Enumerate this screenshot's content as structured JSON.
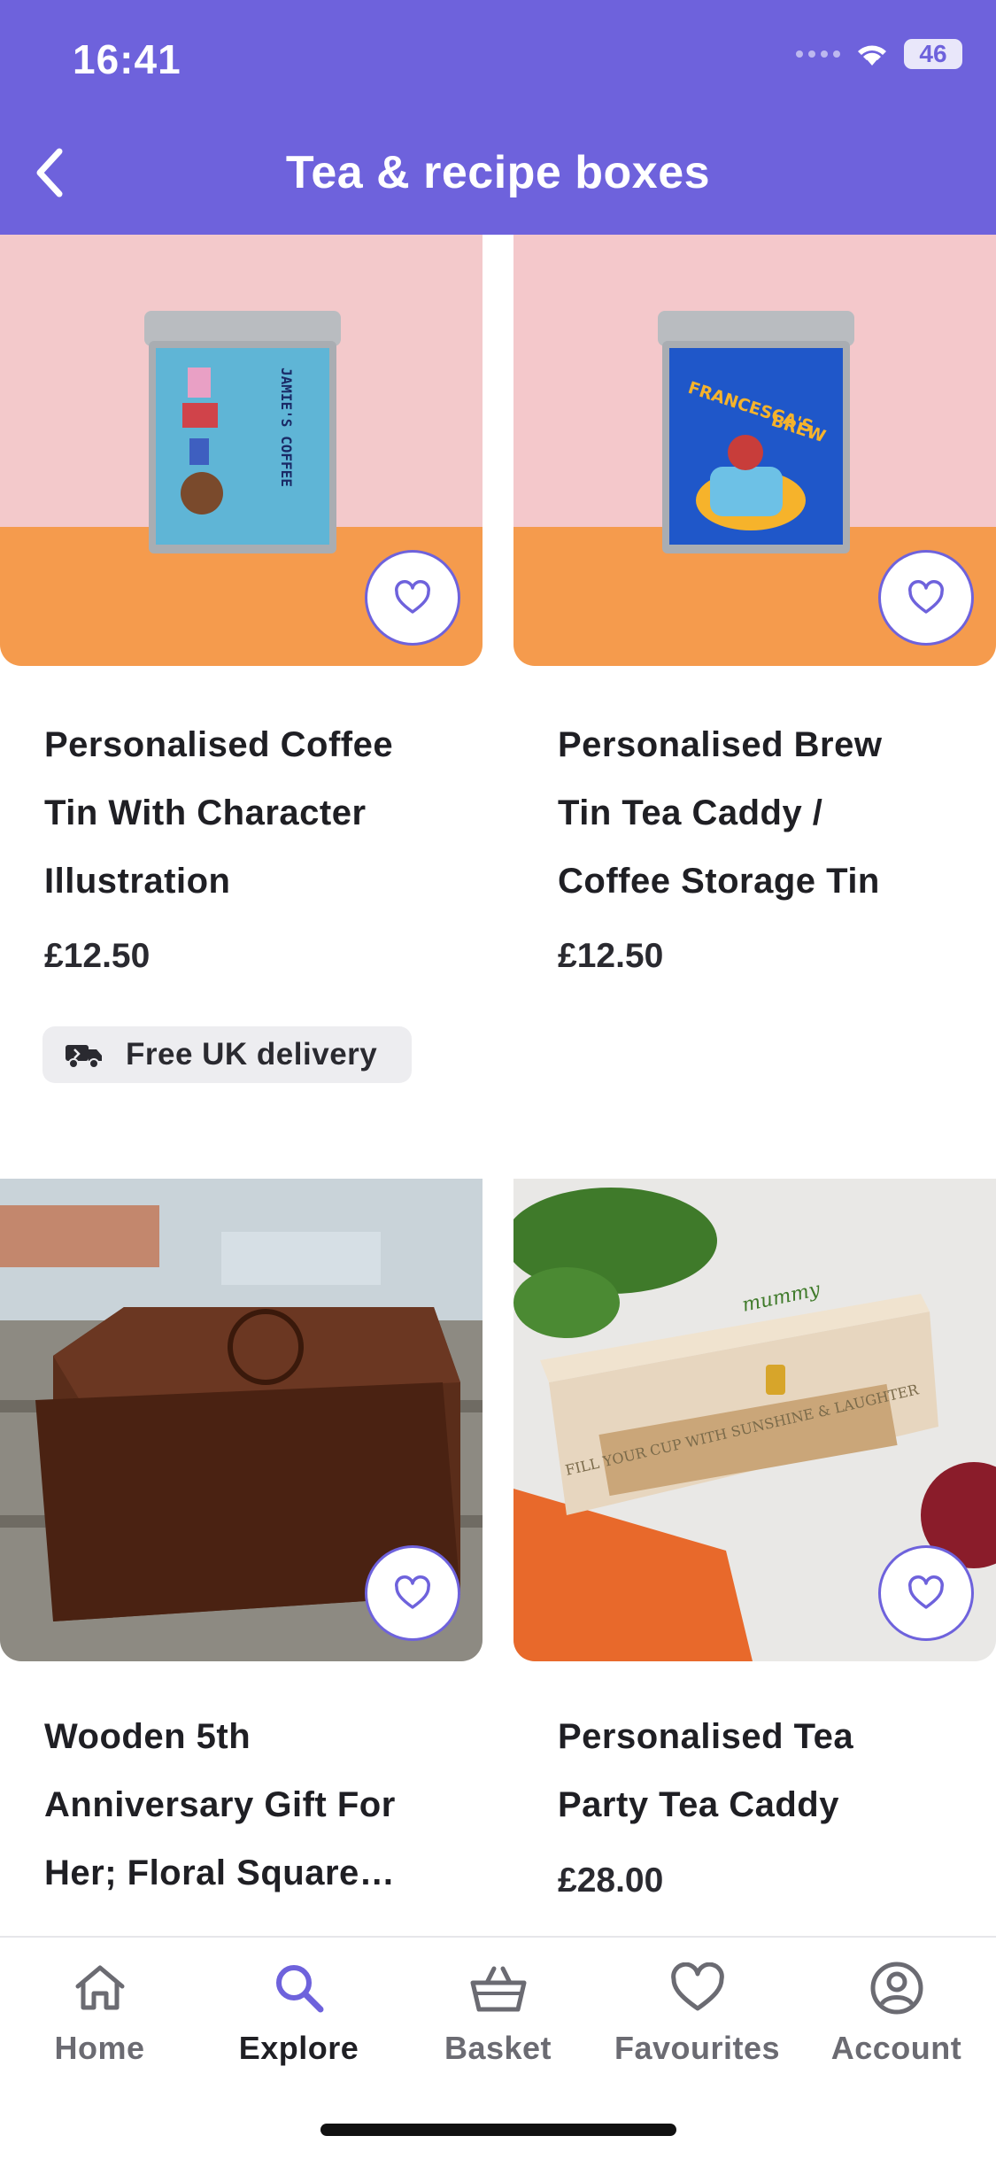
{
  "status": {
    "time": "16:41",
    "battery": "46"
  },
  "header": {
    "title": "Tea & recipe boxes"
  },
  "products": [
    {
      "title_lines": [
        "Personalised Coffee",
        "Tin With Character",
        "Illustration"
      ],
      "price": "£12.50",
      "badge": "Free UK delivery",
      "tin_text": "JAMIE'S COFFEE"
    },
    {
      "title_lines": [
        "Personalised Brew",
        "Tin Tea Caddy /",
        "Coffee Storage Tin"
      ],
      "price": "£12.50",
      "tin_text_1": "FRANCESCA'S",
      "tin_text_2": "BREW"
    },
    {
      "title_lines": [
        "Wooden 5th",
        "Anniversary Gift For",
        "Her; Floral Square…"
      ]
    },
    {
      "title_lines": [
        "Personalised Tea",
        "Party Tea Caddy"
      ],
      "price": "£28.00",
      "box_script": "mummy",
      "box_text": "FILL YOUR CUP WITH SUNSHINE & LAUGHTER"
    }
  ],
  "nav": [
    {
      "label": "Home",
      "icon": "home-icon"
    },
    {
      "label": "Explore",
      "icon": "search-icon",
      "active": true
    },
    {
      "label": "Basket",
      "icon": "basket-icon"
    },
    {
      "label": "Favourites",
      "icon": "heart-icon"
    },
    {
      "label": "Account",
      "icon": "account-icon"
    }
  ],
  "colors": {
    "accent": "#6e62dc",
    "badge_bg": "#ededf0"
  }
}
